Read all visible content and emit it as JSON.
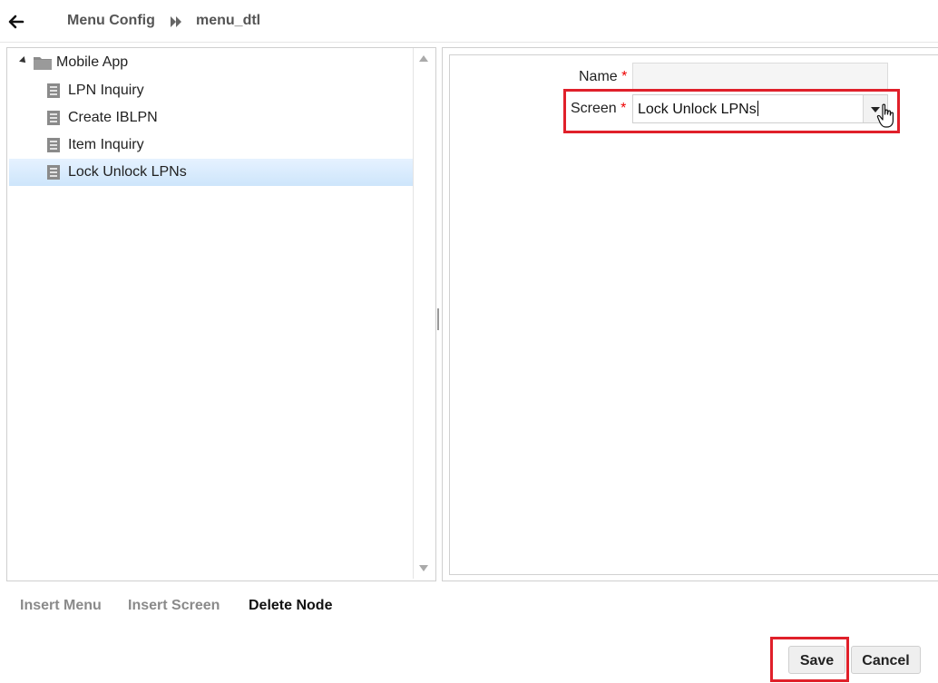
{
  "header": {
    "back_icon": "arrow-left-icon",
    "breadcrumb": [
      "Menu Config",
      "menu_dtl"
    ],
    "separator_icon": "double-chevron-right-icon"
  },
  "tree": {
    "root": {
      "label": "Mobile App",
      "icon": "folder-icon",
      "expanded": true
    },
    "items": [
      {
        "label": "LPN Inquiry",
        "icon": "document-icon",
        "selected": false
      },
      {
        "label": "Create IBLPN",
        "icon": "document-icon",
        "selected": false
      },
      {
        "label": "Item Inquiry",
        "icon": "document-icon",
        "selected": false
      },
      {
        "label": "Lock Unlock LPNs",
        "icon": "document-icon",
        "selected": true
      }
    ]
  },
  "form": {
    "name": {
      "label": "Name",
      "required_mark": "*",
      "value": ""
    },
    "screen": {
      "label": "Screen",
      "required_mark": "*",
      "value": "Lock Unlock LPNs"
    }
  },
  "actions": {
    "insert_menu": "Insert Menu",
    "insert_screen": "Insert Screen",
    "delete_node": "Delete Node"
  },
  "buttons": {
    "save": "Save",
    "cancel": "Cancel"
  },
  "colors": {
    "highlight": "#e0202a",
    "selected_row": "#d6eafc",
    "required": "#ee0000"
  }
}
